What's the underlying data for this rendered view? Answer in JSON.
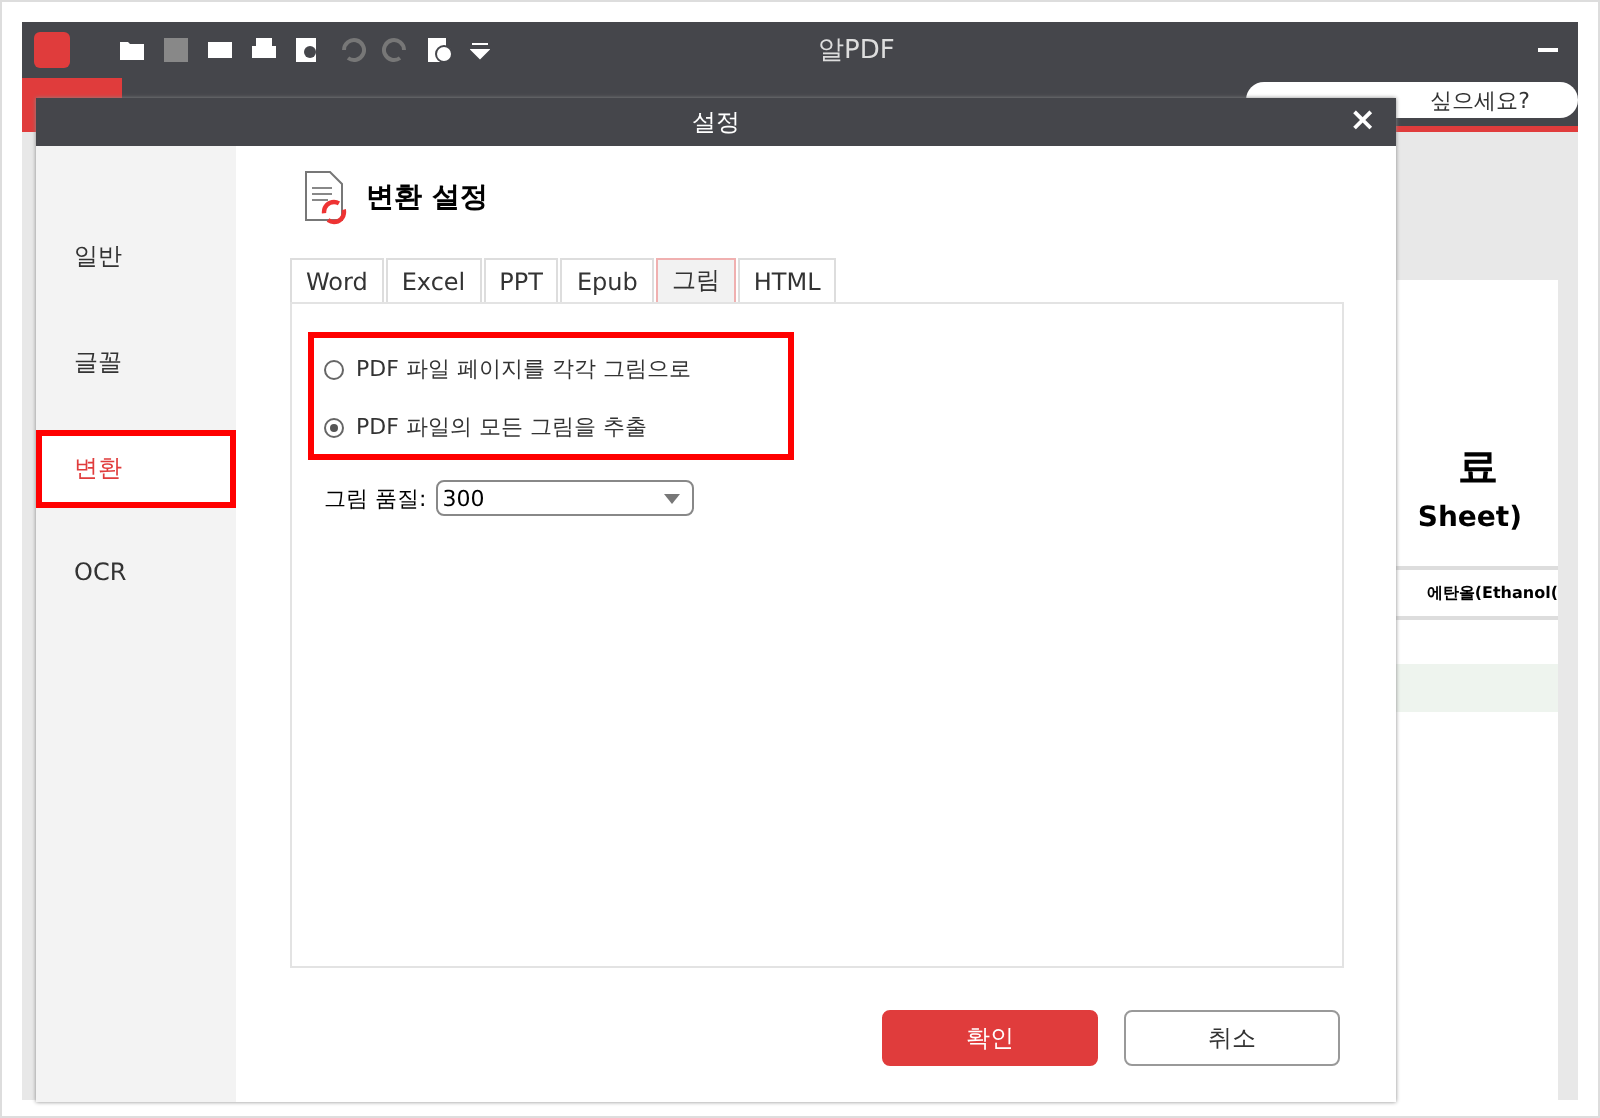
{
  "app": {
    "title": "알PDF",
    "search_placeholder": "싶으세요?",
    "document_texts": [
      "료",
      "Sheet)",
      "에탄올(Ethanol("
    ]
  },
  "dialog": {
    "title": "설정",
    "close": "×",
    "sidebar": [
      {
        "label": "일반",
        "selected": false
      },
      {
        "label": "글꼴",
        "selected": false
      },
      {
        "label": "변환",
        "selected": true
      },
      {
        "label": "OCR",
        "selected": false
      }
    ],
    "heading": "변환 설정",
    "tabs": [
      {
        "label": "Word",
        "selected": false
      },
      {
        "label": "Excel",
        "selected": false
      },
      {
        "label": "PPT",
        "selected": false
      },
      {
        "label": "Epub",
        "selected": false
      },
      {
        "label": "그림",
        "selected": true
      },
      {
        "label": "HTML",
        "selected": false
      }
    ],
    "options": [
      {
        "label": "PDF 파일 페이지를 각각 그림으로",
        "selected": false
      },
      {
        "label": "PDF 파일의 모든 그림을 추출",
        "selected": true
      }
    ],
    "quality": {
      "label": "그림 품질:",
      "value": "300"
    },
    "buttons": [
      {
        "label": "확인",
        "kind": "primary"
      },
      {
        "label": "취소",
        "kind": "secondary"
      }
    ]
  }
}
